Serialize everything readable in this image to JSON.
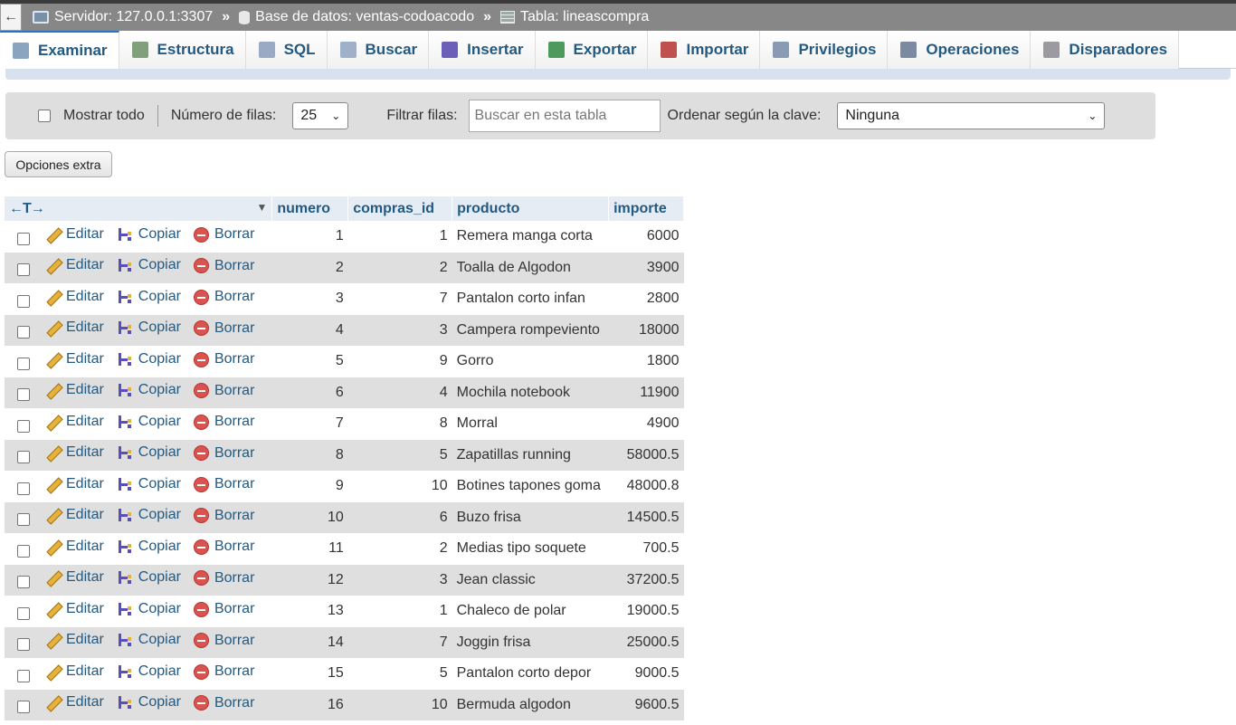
{
  "breadcrumb": {
    "back": "←",
    "server": "Servidor: 127.0.0.1:3307",
    "sep1": "»",
    "database": "Base de datos: ventas-codoacodo",
    "sep2": "»",
    "table": "Tabla: lineascompra"
  },
  "tabs": [
    {
      "label": "Examinar",
      "icon": "browse-icon"
    },
    {
      "label": "Estructura",
      "icon": "structure-icon"
    },
    {
      "label": "SQL",
      "icon": "sql-icon"
    },
    {
      "label": "Buscar",
      "icon": "search-icon"
    },
    {
      "label": "Insertar",
      "icon": "insert-icon"
    },
    {
      "label": "Exportar",
      "icon": "export-icon"
    },
    {
      "label": "Importar",
      "icon": "import-icon"
    },
    {
      "label": "Privilegios",
      "icon": "privileges-icon"
    },
    {
      "label": "Operaciones",
      "icon": "wrench-icon"
    },
    {
      "label": "Disparadores",
      "icon": "triggers-icon"
    }
  ],
  "filters": {
    "show_all": "Mostrar todo",
    "rows_label": "Número de filas:",
    "rows_value": "25",
    "filter_label": "Filtrar filas:",
    "filter_placeholder": "Buscar en esta tabla",
    "sort_label": "Ordenar según la clave:",
    "sort_value": "Ninguna"
  },
  "extra_options": "Opciones extra",
  "table": {
    "arrows": "←T→",
    "columns": [
      "numero",
      "compras_id",
      "producto",
      "importe"
    ],
    "actions": {
      "edit": "Editar",
      "copy": "Copiar",
      "delete": "Borrar"
    },
    "rows": [
      [
        "1",
        "1",
        "Remera manga corta",
        "6000"
      ],
      [
        "2",
        "2",
        "Toalla de Algodon",
        "3900"
      ],
      [
        "3",
        "7",
        "Pantalon corto infan",
        "2800"
      ],
      [
        "4",
        "3",
        "Campera rompeviento",
        "18000"
      ],
      [
        "5",
        "9",
        "Gorro",
        "1800"
      ],
      [
        "6",
        "4",
        "Mochila notebook",
        "11900"
      ],
      [
        "7",
        "8",
        "Morral",
        "4900"
      ],
      [
        "8",
        "5",
        "Zapatillas running",
        "58000.5"
      ],
      [
        "9",
        "10",
        "Botines tapones goma",
        "48000.8"
      ],
      [
        "10",
        "6",
        "Buzo frisa",
        "14500.5"
      ],
      [
        "11",
        "2",
        "Medias tipo soquete",
        "700.5"
      ],
      [
        "12",
        "3",
        "Jean classic",
        "37200.5"
      ],
      [
        "13",
        "1",
        "Chaleco de polar",
        "19000.5"
      ],
      [
        "14",
        "7",
        "Joggin frisa",
        "25000.5"
      ],
      [
        "15",
        "5",
        "Pantalon corto depor",
        "9000.5"
      ],
      [
        "16",
        "10",
        "Bermuda algodon",
        "9600.5"
      ]
    ]
  }
}
